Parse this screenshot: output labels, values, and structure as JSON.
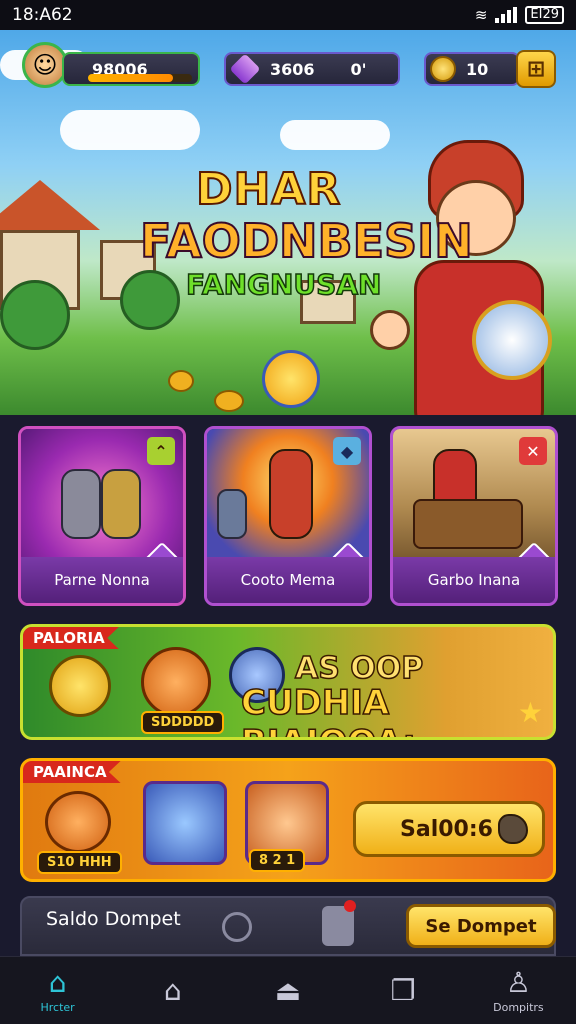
{
  "status_bar": {
    "time": "18:A62",
    "battery": "EI29"
  },
  "top_bar": {
    "player_xp": "98006",
    "gems": "3606",
    "gems_extra": "0'",
    "coins": "10",
    "xp_progress": 0.82
  },
  "hero": {
    "title_line1": "DHAR",
    "title_line2": "FAODNBESIN",
    "title_line3": "FANGNUSAN"
  },
  "game_cards": [
    {
      "label": "Parne Nonna",
      "corner_icon": "chevron-icon"
    },
    {
      "label": "Cooto Mema",
      "corner_icon": "cube-icon"
    },
    {
      "label": "Garbo Inana",
      "corner_icon": "close-icon"
    }
  ],
  "promo_banner": {
    "tag": "PALORIA",
    "line1": "AS OOP",
    "line2": "CUDHIA BIAIOOA:"
  },
  "pet_banner": {
    "tag": "PAAINCA",
    "price_chip": "S10 HHH",
    "counter_chip": "8 2 1",
    "button_label": "Sal00:6"
  },
  "wallet": {
    "title": "Saldo Dompet",
    "button_label": "Se Dompet"
  },
  "bottom_nav": [
    {
      "label": "Hrcter",
      "icon": "home-icon",
      "active": true
    },
    {
      "label": "",
      "icon": "house-outline-icon",
      "active": false
    },
    {
      "label": "",
      "icon": "shop-icon",
      "active": false
    },
    {
      "label": "",
      "icon": "cards-icon",
      "active": false
    },
    {
      "label": "Dompitrs",
      "icon": "profile-icon",
      "active": false
    }
  ],
  "colors": {
    "accent_active": "#2ec4d6",
    "gold": "#ffd23a",
    "card_border": "#b050d0"
  }
}
